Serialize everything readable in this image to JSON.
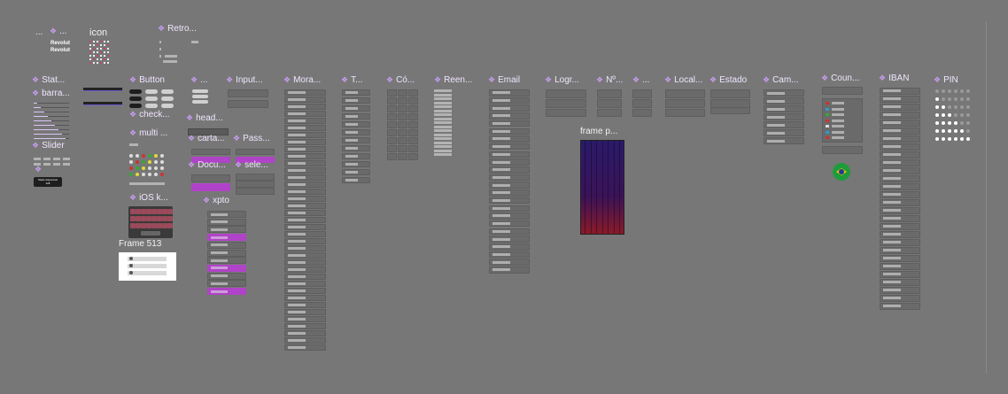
{
  "labels": {
    "ellipsis": "...",
    "icon": "icon",
    "retro": "Retro...",
    "stat": "Stat...",
    "barra": "barra...",
    "slider": "Slider",
    "button": "Button",
    "check": "check...",
    "multi": "multi ...",
    "ios": "iOS k...",
    "frame513": "Frame 513",
    "blank1": "...",
    "head": "head...",
    "carta": "carta...",
    "docu": "Docu...",
    "xpto": "xpto",
    "input": "Input...",
    "pass": "Pass...",
    "sele": "sele...",
    "mora": "Mora...",
    "t": "T...",
    "co": "Có...",
    "reen": "Reen...",
    "email": "Email",
    "logr": "Logr...",
    "no": "Nº...",
    "blank2": "...",
    "local": "Local...",
    "estado": "Estado",
    "cam": "Cam...",
    "coun": "Coun...",
    "iban": "IBAN",
    "pin": "PIN",
    "framep": "frame p..."
  },
  "brand": {
    "line1": "Revolut",
    "line2": "Revolut"
  },
  "slider_button": {
    "line1": "Saldo disponível",
    "line2": "12€"
  },
  "colors": {
    "canvas": "#777777",
    "accent": "#b043c8",
    "field": "#6a6a6a",
    "gradient_top": "#2a1a6a",
    "gradient_bottom": "#8a1a2a"
  },
  "icons": {
    "component": "diamond-component-icon",
    "flag": "brazil-flag-icon"
  }
}
